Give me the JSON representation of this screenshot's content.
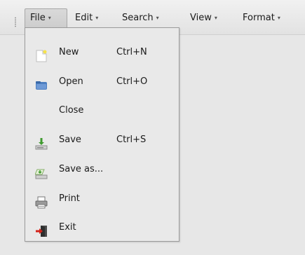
{
  "menubar": {
    "menus": [
      {
        "label": "File",
        "arrow": "▾"
      },
      {
        "label": "Edit",
        "arrow": "▾"
      },
      {
        "label": "Search",
        "arrow": "▾"
      },
      {
        "label": "View",
        "arrow": "▾"
      },
      {
        "label": "Format",
        "arrow": "▾"
      }
    ]
  },
  "file_menu": {
    "items": [
      {
        "label": "New",
        "shortcut": "Ctrl+N",
        "icon": "new-document-icon"
      },
      {
        "label": "Open",
        "shortcut": "Ctrl+O",
        "icon": "open-folder-icon"
      },
      {
        "label": "Close",
        "shortcut": "",
        "icon": ""
      },
      {
        "label": "Save",
        "shortcut": "Ctrl+S",
        "icon": "save-icon"
      },
      {
        "label": "Save as...",
        "shortcut": "",
        "icon": "save-as-icon"
      },
      {
        "label": "Print",
        "shortcut": "",
        "icon": "printer-icon"
      },
      {
        "label": "Exit",
        "shortcut": "",
        "icon": "exit-icon"
      }
    ]
  },
  "colors": {
    "background": "#e7e7e7",
    "menu_background": "#e9e9e9",
    "active_menu": "#d4d4d4",
    "border": "#9b9b9b"
  }
}
